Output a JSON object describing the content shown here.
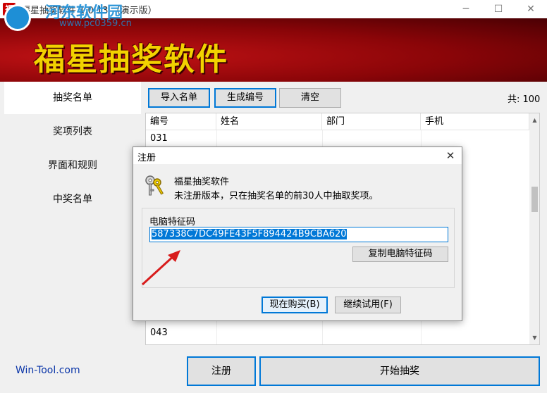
{
  "window": {
    "title": "福星抽奖软件 1.0.13 （演示版）",
    "app_icon_char": "福",
    "minimize_symbol": "─",
    "maximize_symbol": "☐",
    "close_symbol": "✕"
  },
  "banner": {
    "title": "福星抽奖软件",
    "watermark_text": "河东软件园",
    "watermark_url": "www.pc0359.cn"
  },
  "sidebar": {
    "items": [
      {
        "label": "抽奖名单",
        "active": true
      },
      {
        "label": "奖项列表",
        "active": false
      },
      {
        "label": "界面和规则",
        "active": false
      },
      {
        "label": "中奖名单",
        "active": false
      }
    ]
  },
  "toolbar": {
    "import_label": "导入名单",
    "generate_label": "生成编号",
    "clear_label": "清空",
    "count_text": "共: 100"
  },
  "table": {
    "columns": [
      "编号",
      "姓名",
      "部门",
      "手机"
    ],
    "visible_rows": [
      {
        "id": "031"
      },
      {
        "id": "043"
      }
    ]
  },
  "dialog": {
    "title": "注册",
    "close_symbol": "✕",
    "app_name": "福星抽奖软件",
    "message": "未注册版本，只在抽奖名单的前30人中抽取奖项。",
    "group_label": "电脑特征码",
    "machine_code": "587338C7DC49FE43F5F894424B9CBA620",
    "copy_label": "复制电脑特征码",
    "buy_label": "现在购买(B)",
    "trial_label": "继续试用(F)"
  },
  "footer": {
    "link_text": "Win-Tool.com",
    "register_label": "注册",
    "start_label": "开始抽奖"
  },
  "colors": {
    "banner_red": "#8a0508",
    "banner_title": "#f2d200",
    "accent_blue": "#0078d7",
    "link_blue": "#0a35a8"
  }
}
